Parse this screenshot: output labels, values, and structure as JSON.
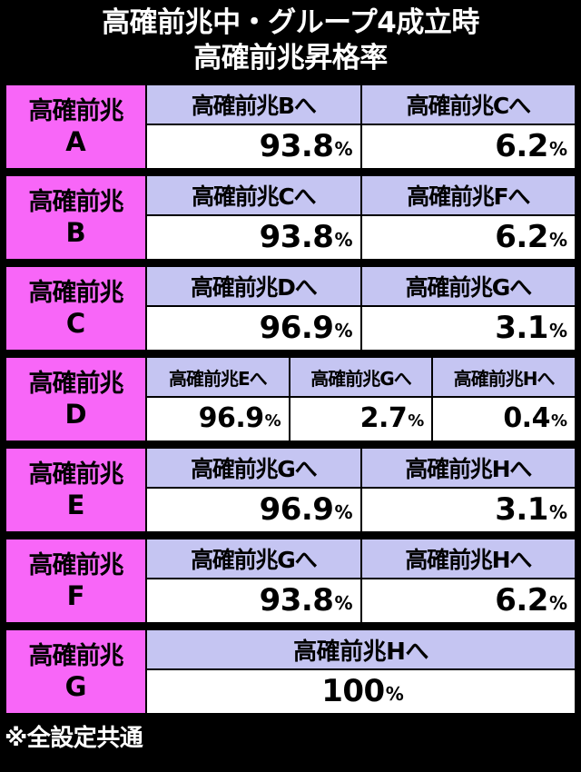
{
  "title": {
    "line1": "高確前兆中・グループ4成立時",
    "line2": "高確前兆昇格率"
  },
  "footnote": "※全設定共通",
  "colors": {
    "background": "#000000",
    "label_pink": "#f866f8",
    "header_blue": "#c5c5f2",
    "cell_white": "#ffffff",
    "border": "#000000",
    "title_text": "#ffffff"
  },
  "percent_symbol": "%",
  "table": {
    "rows": [
      {
        "label_top": "高確前兆",
        "label_bottom": "A",
        "columns": [
          {
            "header": "高確前兆Bへ",
            "value": "93.8"
          },
          {
            "header": "高確前兆Cへ",
            "value": "6.2"
          }
        ]
      },
      {
        "label_top": "高確前兆",
        "label_bottom": "B",
        "columns": [
          {
            "header": "高確前兆Cへ",
            "value": "93.8"
          },
          {
            "header": "高確前兆Fへ",
            "value": "6.2"
          }
        ]
      },
      {
        "label_top": "高確前兆",
        "label_bottom": "C",
        "columns": [
          {
            "header": "高確前兆Dへ",
            "value": "96.9"
          },
          {
            "header": "高確前兆Gへ",
            "value": "3.1"
          }
        ]
      },
      {
        "label_top": "高確前兆",
        "label_bottom": "D",
        "columns": [
          {
            "header": "高確前兆Eへ",
            "value": "96.9"
          },
          {
            "header": "高確前兆Gへ",
            "value": "2.7"
          },
          {
            "header": "高確前兆Hへ",
            "value": "0.4"
          }
        ]
      },
      {
        "label_top": "高確前兆",
        "label_bottom": "E",
        "columns": [
          {
            "header": "高確前兆Gへ",
            "value": "96.9"
          },
          {
            "header": "高確前兆Hへ",
            "value": "3.1"
          }
        ]
      },
      {
        "label_top": "高確前兆",
        "label_bottom": "F",
        "columns": [
          {
            "header": "高確前兆Gへ",
            "value": "93.8"
          },
          {
            "header": "高確前兆Hへ",
            "value": "6.2"
          }
        ]
      },
      {
        "label_top": "高確前兆",
        "label_bottom": "G",
        "columns": [
          {
            "header": "高確前兆Hへ",
            "value": "100"
          }
        ]
      }
    ]
  }
}
